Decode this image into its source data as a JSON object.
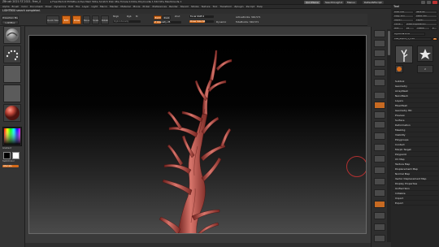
{
  "title_bar": {
    "app_title": "ZBrush 2021 FZ 2021. Free_4",
    "center_text": "▸ Free Mem 6.553GB ▸ Active Mem 504 ▸ Scratch Disk 48 ▸ Timer▸ 0.044 ▸ PolyCount▸ 1.542 KP ▸ MeshCount▸ 1",
    "quicksave_label": "QuickSave",
    "seethrough_label": "See-through 0",
    "menus_label": "Menus",
    "script_label": "DefaultZScript"
  },
  "menu_bar": {
    "items": [
      "Alpha",
      "Brush",
      "Color",
      "Document",
      "Draw",
      "Dynamics",
      "Edit",
      "File",
      "Layer",
      "Light",
      "Macro",
      "Marker",
      "Material",
      "Movie",
      "Picker",
      "Preferences",
      "Render",
      "Stencil",
      "Stroke",
      "Texture",
      "Tool",
      "Transform",
      "Zplugin",
      "Zscript",
      "Help"
    ]
  },
  "status": {
    "message": "LIGHTBOX search completed."
  },
  "shelf": {
    "projection_master": "Projection Master",
    "lightbox": "LightBox",
    "quick_sketch": "Quick Sketch",
    "edit": "Edit",
    "draw": "Draw",
    "move": "Move",
    "scale": "Scale",
    "rotate": "Rotate",
    "mrgb": "Mrgb",
    "rgb": "Rgb",
    "m": "M",
    "rgb_intensity": "Rgb Intensity",
    "zadd": "Zadd",
    "zsub": "Zsub",
    "zcut": "Zcut",
    "focal_shift": "Focal Shift 0",
    "draw_size": "Draw Size 64",
    "z_intensity": "Z Intensity 25",
    "dynamic": "Dynamic",
    "active_points": "ActivePoints: 346,571",
    "total_points": "TotalPoints: 346,571",
    "z_intensity_value": 0.25,
    "draw_size_value": 0.64
  },
  "tool_palette": {
    "title": "Tool",
    "load_tool": "Load Tool",
    "save_as": "Save As",
    "copy_tool": "Copy Tool",
    "paste_tool": "Paste Tool",
    "import": "Import",
    "export": "Export",
    "clone": "Clone",
    "make_polymesh": "Make PolyMesh3D",
    "goz": "GoZ",
    "all": "All",
    "visible": "Visible",
    "r": "R",
    "lightbox_tools": "Lightbox▸Tools",
    "current_tool": "tree_export_1_1.48",
    "r_label": "R",
    "tool_count": "2",
    "subpalettes": [
      "Subtool",
      "Geometry",
      "ArrayMesh",
      "NanoMesh",
      "Layers",
      "FiberMesh",
      "Geometry HD",
      "Preview",
      "Surface",
      "Deformation",
      "Masking",
      "Visibility",
      "Polygroups",
      "Contact",
      "Morph Target",
      "Polypaint",
      "UV Map",
      "Texture Map",
      "Displacement Map",
      "Normal Map",
      "Vector Displacement Map",
      "Display Properties",
      "Unified Skin",
      "Initialize",
      "Import",
      "Export"
    ]
  },
  "left_tray": {
    "gradient_label": "Gradient",
    "switch_color": "SwitchColor",
    "alternate": "Alternate"
  },
  "colors": {
    "accent": "#d46a1a",
    "tree_fill": "#b5483f",
    "tree_highlight": "#d7756b",
    "tree_shadow": "#6b1f1c"
  }
}
